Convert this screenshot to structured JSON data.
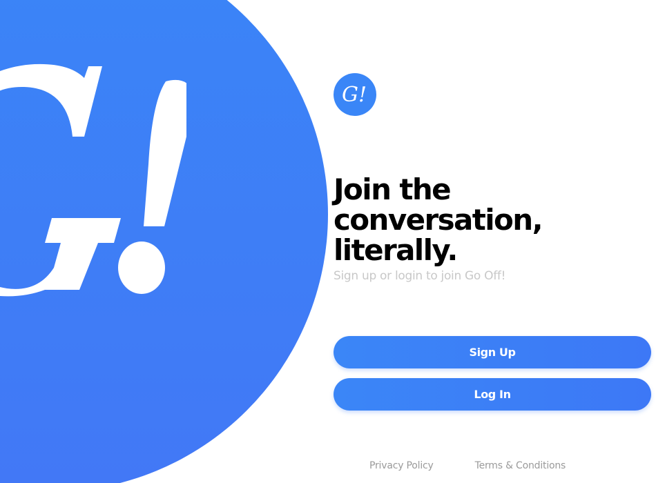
{
  "brand": {
    "logo_text": "G!",
    "icon": "go-off-logo-icon",
    "primary_color": "#3a86f7"
  },
  "hero": {
    "icon": "go-off-large-logo-icon",
    "circle_color": "#3a85f7"
  },
  "headline": {
    "line1": "Join the",
    "line2": "conversation,",
    "line3": "literally."
  },
  "subtitle": "Sign up or login to join Go Off!",
  "buttons": {
    "signup_label": "Sign Up",
    "login_label": "Log In"
  },
  "footer": {
    "privacy_label": "Privacy Policy",
    "terms_label": "Terms & Conditions"
  }
}
